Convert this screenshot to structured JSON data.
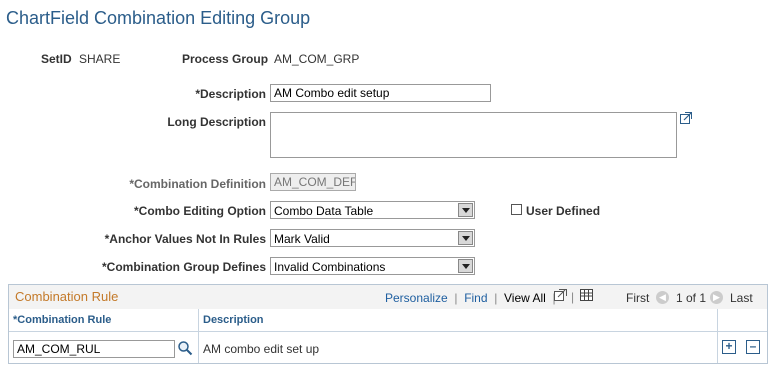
{
  "page": {
    "title": "ChartField Combination Editing Group"
  },
  "header": {
    "setid_label": "SetID",
    "setid_value": "SHARE",
    "process_group_label": "Process Group",
    "process_group_value": "AM_COM_GRP"
  },
  "form": {
    "description_label": "*Description",
    "description_value": "AM Combo edit setup",
    "long_description_label": "Long Description",
    "long_description_value": "",
    "combination_definition_label": "*Combination Definition",
    "combination_definition_value": "AM_COM_DEF",
    "combo_editing_option_label": "*Combo Editing Option",
    "combo_editing_option_value": "Combo Data Table",
    "user_defined_label": "User Defined",
    "anchor_values_label": "*Anchor Values Not In Rules",
    "anchor_values_value": "Mark Valid",
    "combination_group_defines_label": "*Combination Group Defines",
    "combination_group_defines_value": "Invalid Combinations"
  },
  "grid": {
    "title": "Combination Rule",
    "personalize": "Personalize",
    "find": "Find",
    "view_all": "View All",
    "first": "First",
    "range": "1 of 1",
    "last": "Last",
    "columns": [
      "*Combination Rule",
      "Description"
    ],
    "rows": [
      {
        "rule": "AM_COM_RUL",
        "description": "AM combo edit set up"
      }
    ]
  }
}
